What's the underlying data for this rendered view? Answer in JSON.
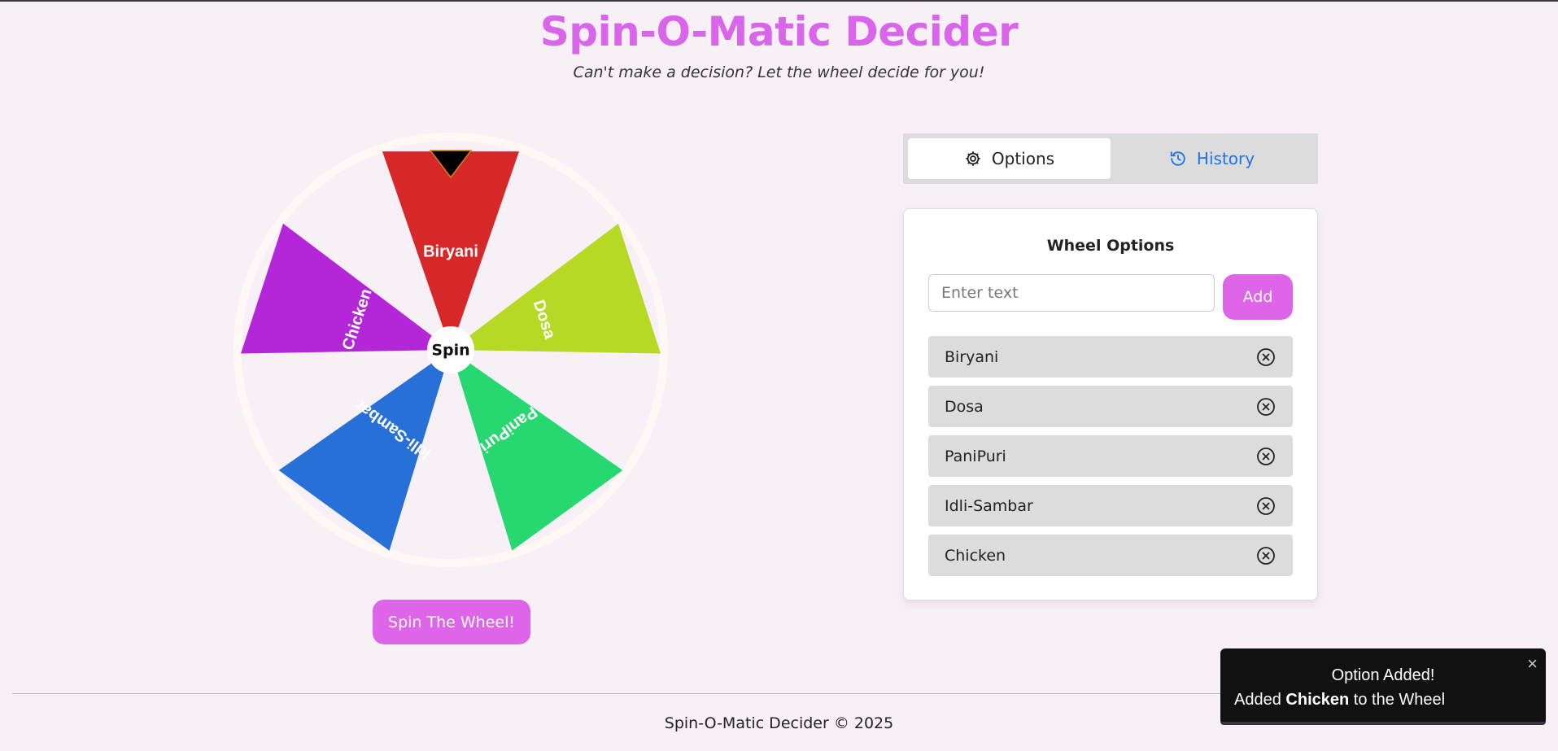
{
  "header": {
    "title": "Spin-O-Matic Decider",
    "subtitle": "Can't make a decision? Let the wheel decide for you!"
  },
  "wheel": {
    "center_label": "Spin",
    "segments": [
      {
        "label": "Biryani",
        "color": "#d62828"
      },
      {
        "label": "Dosa",
        "color": "#b5d925"
      },
      {
        "label": "PaniPuri",
        "color": "#26d86f"
      },
      {
        "label": "Idli-Sambar",
        "color": "#2670d8"
      },
      {
        "label": "Chicken",
        "color": "#b327d8"
      }
    ],
    "pointer_color": "#000000",
    "spin_button_label": "Spin The Wheel!"
  },
  "tabs": {
    "options_label": "Options",
    "history_label": "History",
    "active": "Options"
  },
  "options_panel": {
    "title": "Wheel Options",
    "input_placeholder": "Enter text",
    "input_value": "",
    "add_label": "Add",
    "items": [
      {
        "label": "Biryani"
      },
      {
        "label": "Dosa"
      },
      {
        "label": "PaniPuri"
      },
      {
        "label": "Idli-Sambar"
      },
      {
        "label": "Chicken"
      }
    ]
  },
  "footer": {
    "text": "Spin-O-Matic Decider © 2025"
  },
  "toast": {
    "title": "Option Added!",
    "body_prefix": "Added",
    "body_item": "Chicken",
    "body_suffix": "to the Wheel",
    "close_label": "×"
  },
  "colors": {
    "accent": "#de65ea",
    "title": "#d966ea",
    "link": "#1e73e8",
    "background": "#f7f1f7"
  },
  "icons": {
    "options_tab": "gear-icon",
    "history_tab": "history-icon",
    "remove": "circle-x-icon",
    "pointer": "triangle-pointer-icon"
  }
}
